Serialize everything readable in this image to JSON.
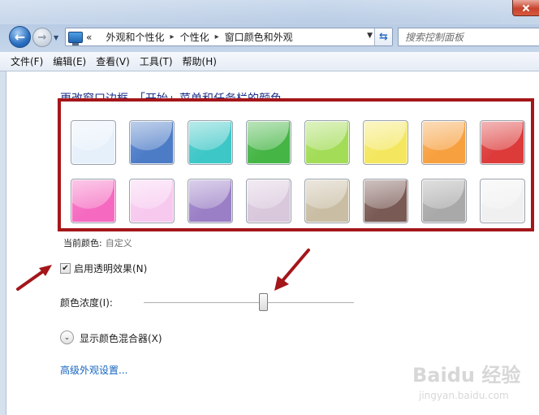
{
  "window": {
    "breadcrumbs": [
      "«",
      "外观和个性化",
      "个性化",
      "窗口颜色和外观"
    ],
    "search_placeholder": "搜索控制面板"
  },
  "menu": [
    "文件(F)",
    "编辑(E)",
    "查看(V)",
    "工具(T)",
    "帮助(H)"
  ],
  "page": {
    "heading": "更改窗口边框、「开始」菜单和任务栏的颜色",
    "current_color_label": "当前颜色:",
    "current_color_value": "自定义",
    "transparency_label": "启用透明效果(N)",
    "transparency_checked": true,
    "intensity_label": "颜色浓度(I):",
    "intensity_fraction": 0.57,
    "mixer_label": "显示颜色混合器(X)",
    "advanced_link": "高级外观设置..."
  },
  "swatches": [
    [
      "#e6f0fb",
      "#4d7cc7",
      "#3ec7c7",
      "#45b545",
      "#a3dc57",
      "#f4e75f",
      "#f7a03f",
      "#dd3a3a"
    ],
    [
      "#f56ac0",
      "#f7c9ef",
      "#9b7fc6",
      "#d9c7dc",
      "#c9bda4",
      "#7a5a55",
      "#a9a9a9",
      "#f0f0f0"
    ]
  ],
  "highlight_color": "#a4161a",
  "watermark": {
    "main": "Baidu 经验",
    "sub": "jingyan.baidu.com"
  }
}
